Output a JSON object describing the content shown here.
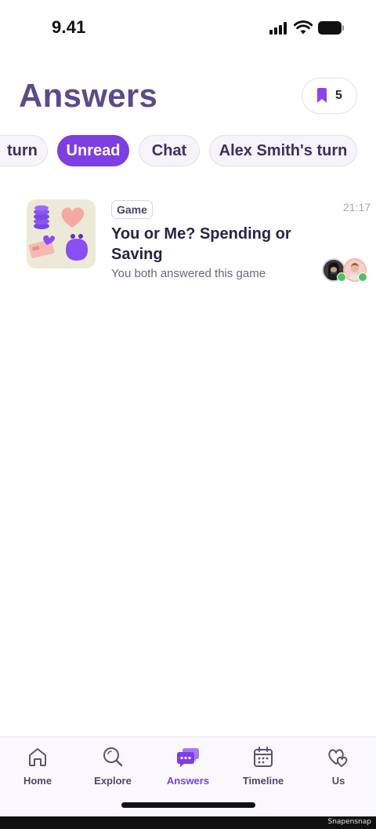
{
  "status_bar": {
    "time": "9.41",
    "icons": [
      "signal-icon",
      "wifi-icon",
      "battery-icon"
    ]
  },
  "header": {
    "title": "Answers",
    "bookmark_count": "5"
  },
  "filters": {
    "items": [
      {
        "label": "turn",
        "active": false
      },
      {
        "label": "Unread",
        "active": true
      },
      {
        "label": "Chat",
        "active": false
      },
      {
        "label": "Alex Smith's turn",
        "active": false
      }
    ]
  },
  "list": {
    "items": [
      {
        "tag": "Game",
        "time": "21:17",
        "title": "You or Me? Spending or Saving",
        "subtitle": "You both answered this game"
      }
    ]
  },
  "tabs": {
    "items": [
      {
        "label": "Home",
        "icon": "home-icon",
        "active": false
      },
      {
        "label": "Explore",
        "icon": "search-icon",
        "active": false
      },
      {
        "label": "Answers",
        "icon": "chat-bubbles-icon",
        "active": true
      },
      {
        "label": "Timeline",
        "icon": "calendar-icon",
        "active": false
      },
      {
        "label": "Us",
        "icon": "hearts-icon",
        "active": false
      }
    ]
  },
  "watermark": "Snapensnap",
  "colors": {
    "accent": "#7e3ee3",
    "title": "#5b4b8a",
    "text_dark": "#2a2246",
    "success": "#4cc35e"
  }
}
